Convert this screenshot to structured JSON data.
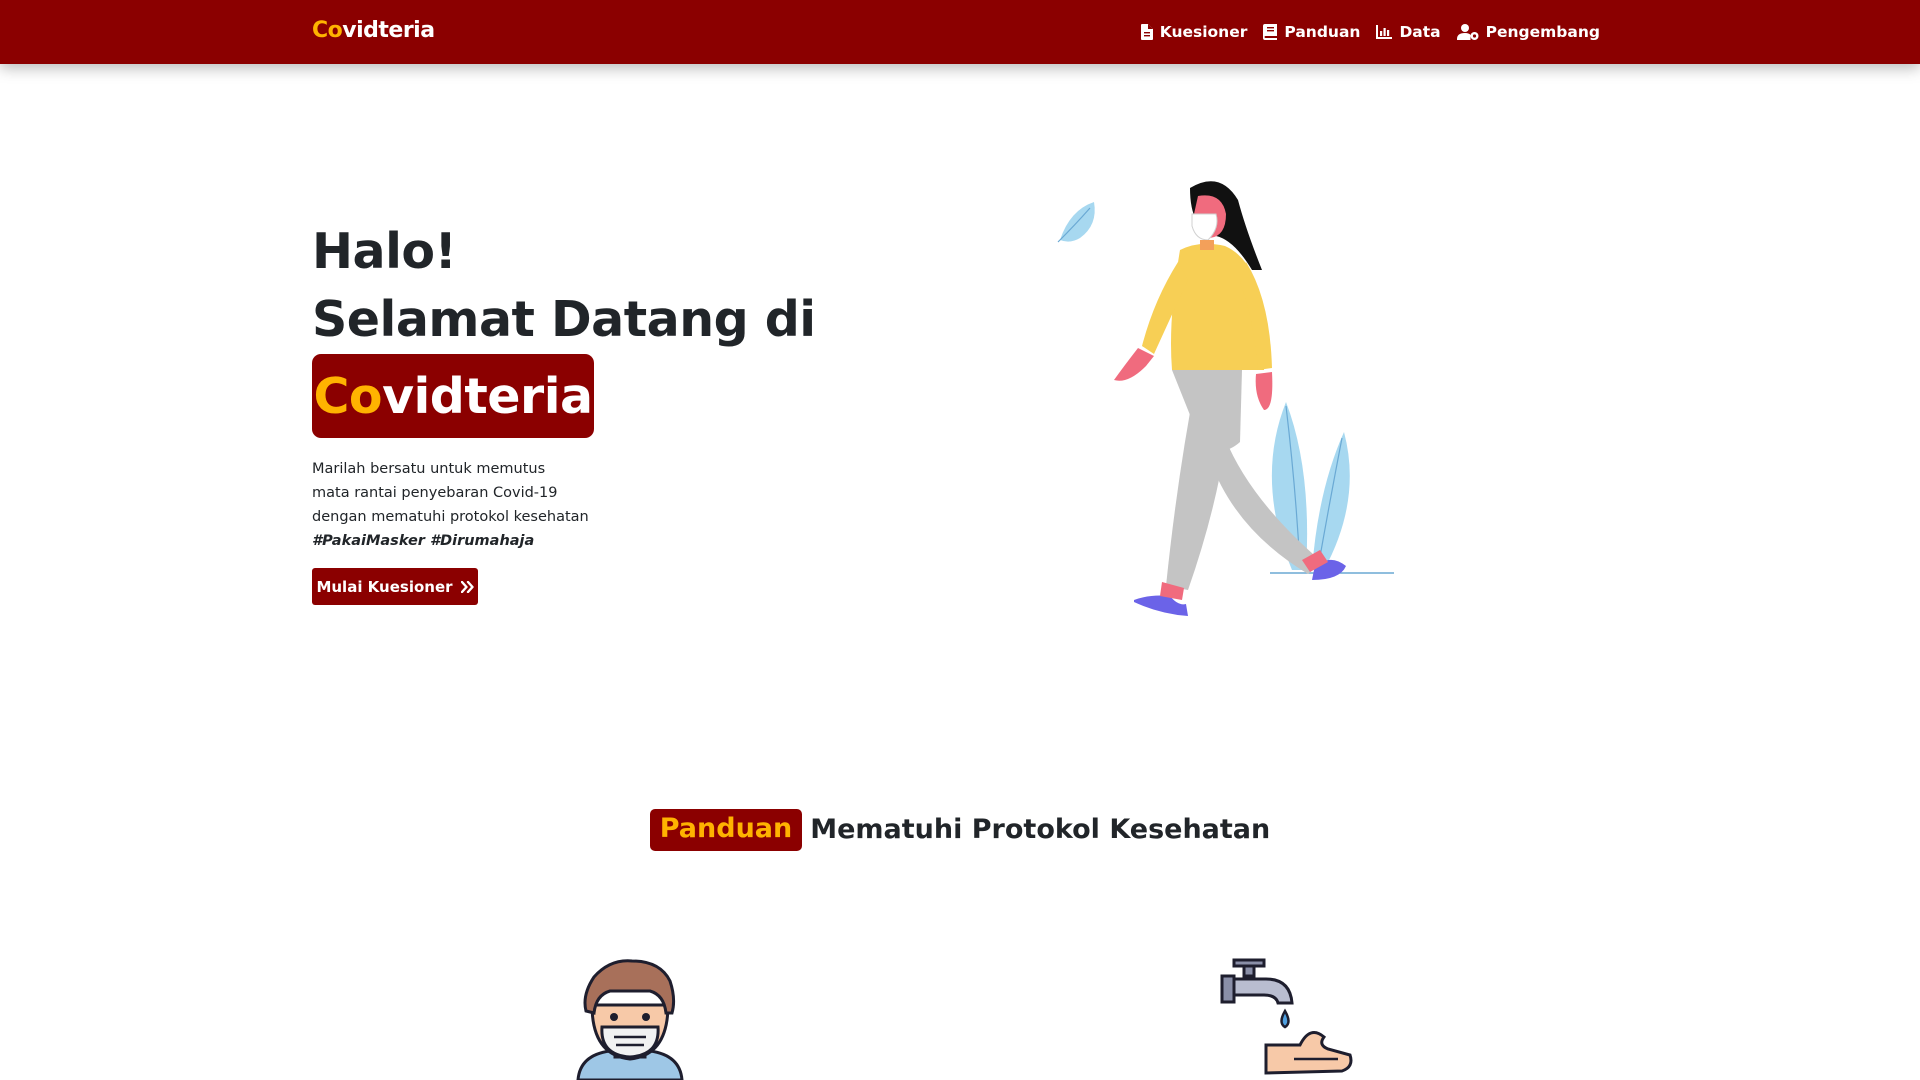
{
  "navbar": {
    "brand_accent": "Co",
    "brand_rest": "vidteria",
    "links": [
      {
        "label": "Kuesioner",
        "icon": "file-icon"
      },
      {
        "label": "Panduan",
        "icon": "book-icon"
      },
      {
        "label": "Data",
        "icon": "chart-icon"
      },
      {
        "label": "Pengembang",
        "icon": "users-cog-icon"
      }
    ]
  },
  "hero": {
    "greeting": "Halo!",
    "welcome": "Selamat Datang di",
    "badge_accent": "Co",
    "badge_rest": "vidteria",
    "text_lines": [
      "Marilah bersatu untuk memutus",
      "mata rantai penyebaran Covid-19",
      "dengan mematuhi protokol kesehatan"
    ],
    "hashtags": "#PakaiMasker #Dirumahaja",
    "cta_label": "Mulai Kuesioner",
    "cta_icon": "double-chevron-right-icon"
  },
  "section": {
    "badge": "Panduan",
    "title": "Mematuhi Protokol Kesehatan"
  },
  "colors": {
    "primary": "#8b0000",
    "accent": "#ffb300",
    "text": "#212529"
  }
}
